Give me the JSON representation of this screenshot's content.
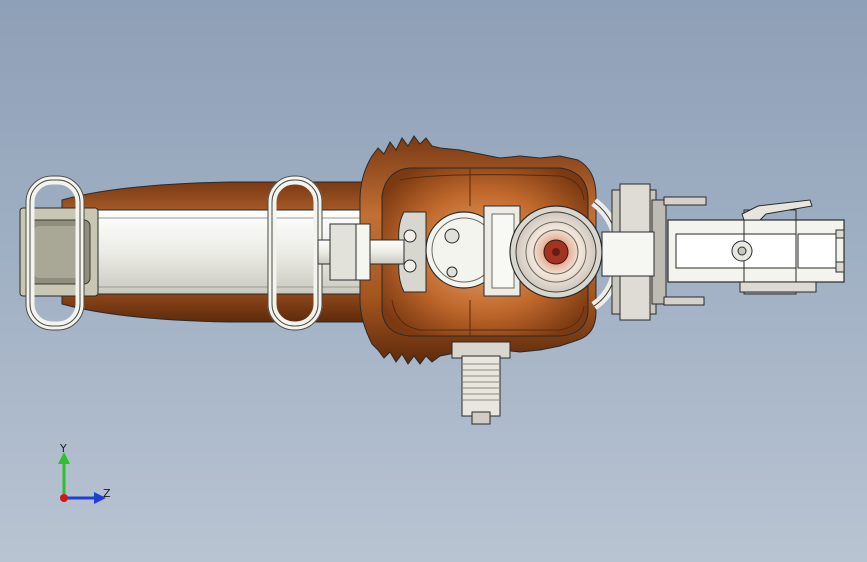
{
  "viewport": {
    "background_top": "#8ea0b7",
    "background_bottom": "#b9c4d2"
  },
  "model": {
    "colors": {
      "copper": "#b7652b",
      "copper_light": "#e0a070",
      "copper_dark": "#6e3210",
      "steel": "#e8e8e4",
      "steel_shadow": "#b5b5ae",
      "outline": "#2a2a2a",
      "handle_grey": "#b9b8a6"
    }
  },
  "triad": {
    "y_label": "Y",
    "z_label": "Z",
    "y_color": "#2fbf2f",
    "z_color": "#1f3fd6",
    "x_color": "#d01818"
  }
}
